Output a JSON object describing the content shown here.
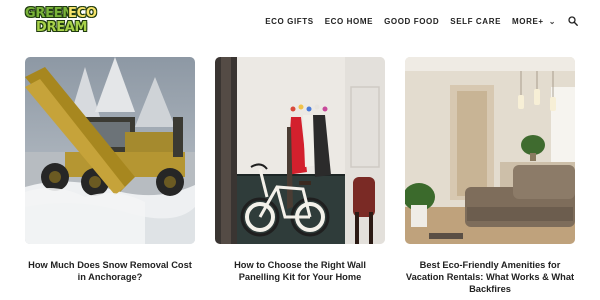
{
  "site": {
    "logo": {
      "word1": "GREEN",
      "word2": "ECO",
      "word3": "DREAM"
    }
  },
  "nav": {
    "items": [
      "ECO GIFTS",
      "ECO HOME",
      "GOOD FOOD",
      "SELF CARE",
      "MORE+"
    ],
    "more_chevron": "chevron-down-icon",
    "search_icon": "search-icon"
  },
  "articles": [
    {
      "title": "How Much Does Snow Removal Cost in Anchorage?",
      "image": "snow-plow-grader-photo"
    },
    {
      "title": "How to Choose the Right Wall Panelling Kit for Your Home",
      "image": "hallway-coat-rack-bicycle-photo"
    },
    {
      "title": "Best Eco-Friendly Amenities for Vacation Rentals: What Works & What Backfires",
      "image": "living-room-interior-photo"
    }
  ]
}
